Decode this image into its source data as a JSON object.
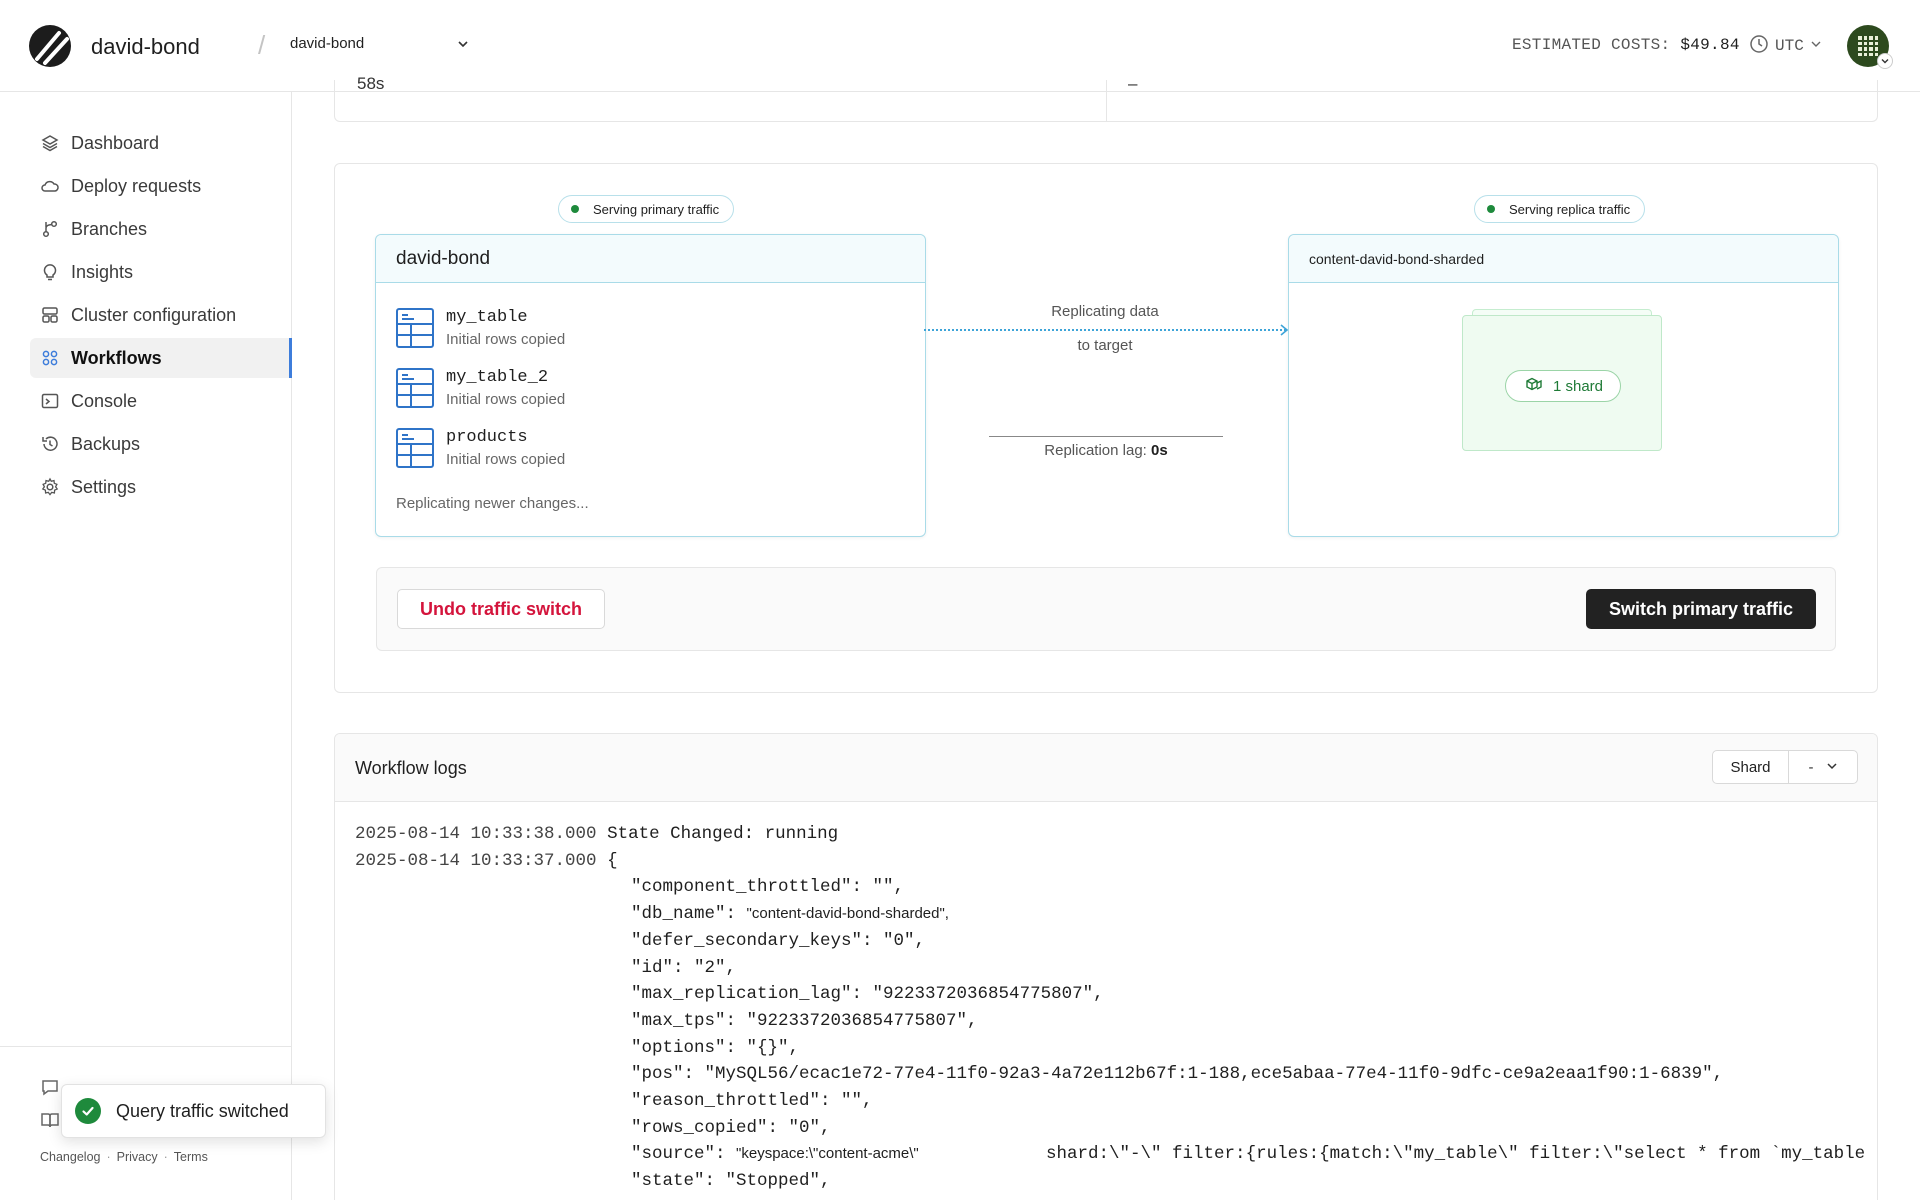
{
  "header": {
    "org_name": "david-bond",
    "database": "david-bond",
    "costs_label": "ESTIMATED COSTS:",
    "costs_value": "$49.84",
    "timezone": "UTC"
  },
  "sidebar": {
    "items": [
      {
        "label": "Dashboard",
        "icon": "layers-icon"
      },
      {
        "label": "Deploy requests",
        "icon": "cloud-icon"
      },
      {
        "label": "Branches",
        "icon": "branch-icon"
      },
      {
        "label": "Insights",
        "icon": "lightbulb-icon"
      },
      {
        "label": "Cluster configuration",
        "icon": "cluster-icon"
      },
      {
        "label": "Workflows",
        "icon": "workflow-icon",
        "active": true
      },
      {
        "label": "Console",
        "icon": "terminal-icon"
      },
      {
        "label": "Backups",
        "icon": "history-icon"
      },
      {
        "label": "Settings",
        "icon": "gear-icon"
      }
    ],
    "footer": {
      "changelog": "Changelog",
      "privacy": "Privacy",
      "terms": "Terms"
    }
  },
  "top_card": {
    "left_text": "58s",
    "right_text": "–"
  },
  "workflow": {
    "source_pill": "Serving primary traffic",
    "target_pill": "Serving replica traffic",
    "source": {
      "name": "david-bond",
      "tables": [
        {
          "name": "my_table",
          "status": "Initial rows copied"
        },
        {
          "name": "my_table_2",
          "status": "Initial rows copied"
        },
        {
          "name": "products",
          "status": "Initial rows copied"
        }
      ],
      "footer": "Replicating newer changes..."
    },
    "replicating_line1": "Replicating data",
    "replicating_line2": "to target",
    "lag_label": "Replication lag:",
    "lag_value": "0s",
    "target": {
      "name": "content-david-bond-sharded",
      "shard_label": "1 shard"
    },
    "undo_button": "Undo traffic switch",
    "switch_button": "Switch primary traffic"
  },
  "logs": {
    "title": "Workflow logs",
    "shard_label": "Shard",
    "shard_value": "-",
    "lines": [
      {
        "ts": "2025-08-14 10:33:38.000",
        "text": "State Changed: running"
      },
      {
        "ts": "2025-08-14 10:33:37.000",
        "text": "{"
      }
    ],
    "json_lines": [
      "\"component_throttled\": \"\",",
      "\"db_name\": ",
      "\"defer_secondary_keys\": \"0\",",
      "\"id\": \"2\",",
      "\"max_replication_lag\": \"9223372036854775807\",",
      "\"max_tps\": \"9223372036854775807\",",
      "\"options\": \"{}\",",
      "\"pos\": \"MySQL56/ecac1e72-77e4-11f0-92a3-4a72e112b67f:1-188,ece5abaa-77e4-11f0-9dfc-ce9a2eaa1f90:1-6839\",",
      "\"reason_throttled\": \"\",",
      "\"rows_copied\": \"0\",",
      "\"source\": ",
      "\"state\": \"Stopped\","
    ],
    "db_name_value": "\"content-david-bond-sharded\",",
    "source_value": "\"keyspace:\\\"content-acme\\\"",
    "source_rest": "shard:\\\"-\\\" filter:{rules:{match:\\\"my_table\\\" filter:\\\"select * from `my_table"
  },
  "toast": {
    "message": "Query traffic switched"
  }
}
